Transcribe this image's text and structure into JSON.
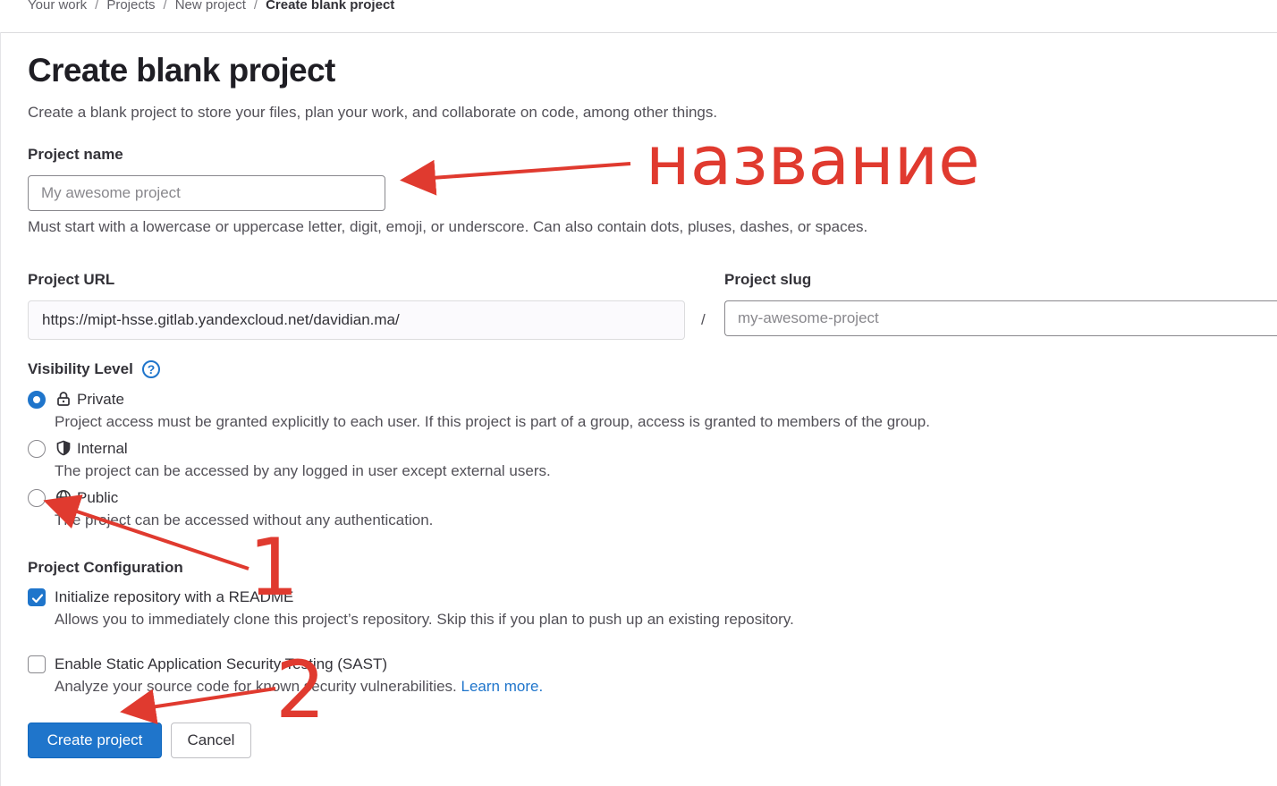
{
  "breadcrumb": {
    "items": [
      "Your work",
      "Projects",
      "New project"
    ],
    "current": "Create blank project",
    "separator": "/"
  },
  "page": {
    "title": "Create blank project",
    "description": "Create a blank project to store your files, plan your work, and collaborate on code, among other things."
  },
  "project_name": {
    "label": "Project name",
    "value": "",
    "placeholder": "My awesome project",
    "hint": "Must start with a lowercase or uppercase letter, digit, emoji, or underscore. Can also contain dots, pluses, dashes, or spaces."
  },
  "project_url": {
    "label": "Project URL",
    "prefix": "https://mipt-hsse.gitlab.yandexcloud.net/davidian.ma/",
    "separator": "/"
  },
  "project_slug": {
    "label": "Project slug",
    "value": "",
    "placeholder": "my-awesome-project"
  },
  "visibility": {
    "label": "Visibility Level",
    "help_icon": "question-circle-icon",
    "options": [
      {
        "label": "Private",
        "icon": "lock-icon",
        "checked": true,
        "description": "Project access must be granted explicitly to each user. If this project is part of a group, access is granted to members of the group."
      },
      {
        "label": "Internal",
        "icon": "shield-icon",
        "checked": false,
        "description": "The project can be accessed by any logged in user except external users."
      },
      {
        "label": "Public",
        "icon": "globe-icon",
        "checked": false,
        "description": "The project can be accessed without any authentication."
      }
    ]
  },
  "configuration": {
    "label": "Project Configuration",
    "readme": {
      "label": "Initialize repository with a README",
      "checked": true,
      "description": "Allows you to immediately clone this project’s repository. Skip this if you plan to push up an existing repository."
    },
    "sast": {
      "label": "Enable Static Application Security Testing (SAST)",
      "checked": false,
      "description": "Analyze your source code for known security vulnerabilities.",
      "link": "Learn more."
    }
  },
  "actions": {
    "create": "Create project",
    "cancel": "Cancel"
  },
  "annotations": {
    "name_note": "название",
    "step_one": "1",
    "step_two": "2",
    "color": "#e03a2f"
  },
  "colors": {
    "primary": "#1f75cb",
    "text": "#333238",
    "muted": "#535158",
    "border": "#89888d"
  }
}
